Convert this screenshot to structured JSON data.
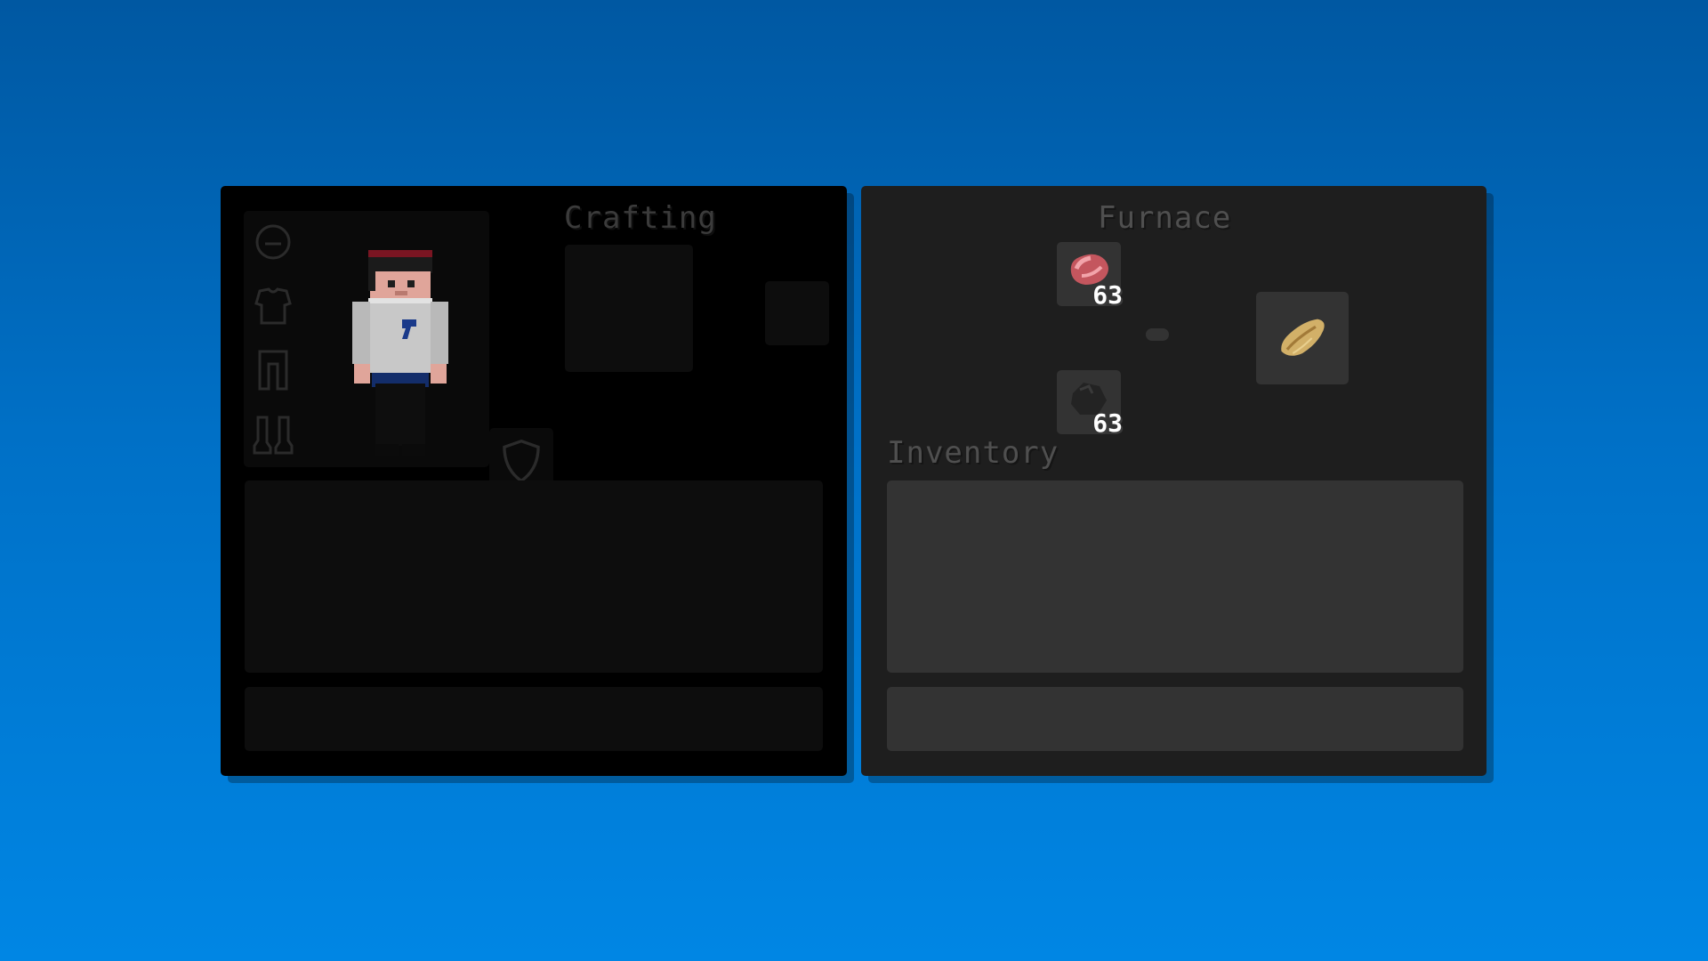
{
  "player_panel": {
    "crafting_label": "Crafting",
    "armor_slots": [
      "helmet-icon",
      "chestplate-icon",
      "leggings-icon",
      "boots-icon"
    ],
    "offhand_icon": "shield-icon"
  },
  "furnace_panel": {
    "title": "Furnace",
    "inventory_label": "Inventory",
    "input": {
      "item": "raw-meat-icon",
      "count": "63"
    },
    "fuel": {
      "item": "coal-icon",
      "count": "63"
    },
    "output": {
      "item": "baked-potato-icon"
    },
    "progress_icon": "progress-arrow-icon"
  },
  "colors": {
    "background_top": "#0058a2",
    "background_bottom": "#0086e4",
    "player_panel_bg": "#000000",
    "furnace_panel_bg": "#1e1e1e"
  }
}
